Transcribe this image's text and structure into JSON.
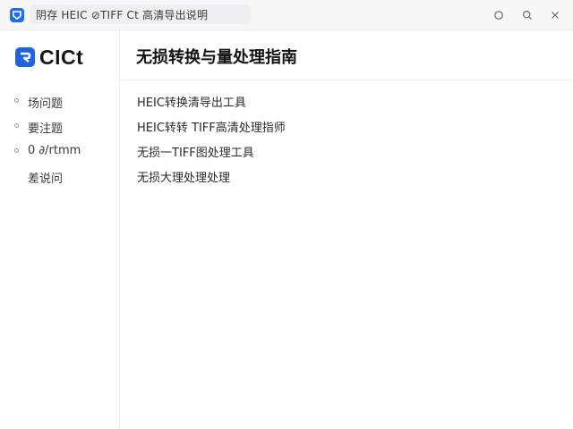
{
  "window": {
    "tab_title": "阴存  HEIC  ⊘TIFF Ct 高清导出说明"
  },
  "brand": {
    "logo_text": "CICt",
    "accent": "#1e63e0"
  },
  "sidebar": {
    "items": [
      {
        "label": "场问题",
        "bullet": true
      },
      {
        "label": "要注题",
        "bullet": true
      },
      {
        "label": "0 ∂/rtmm",
        "bullet": true
      },
      {
        "label": "差说问",
        "bullet": false
      }
    ]
  },
  "main": {
    "title": "无损转换与量处理指南",
    "links": [
      "HEIC转换清导出工具",
      "HEIC转转 TIFF高清处理指师",
      "无损一TIFF图处理工具",
      "无损大理处理处理"
    ]
  }
}
